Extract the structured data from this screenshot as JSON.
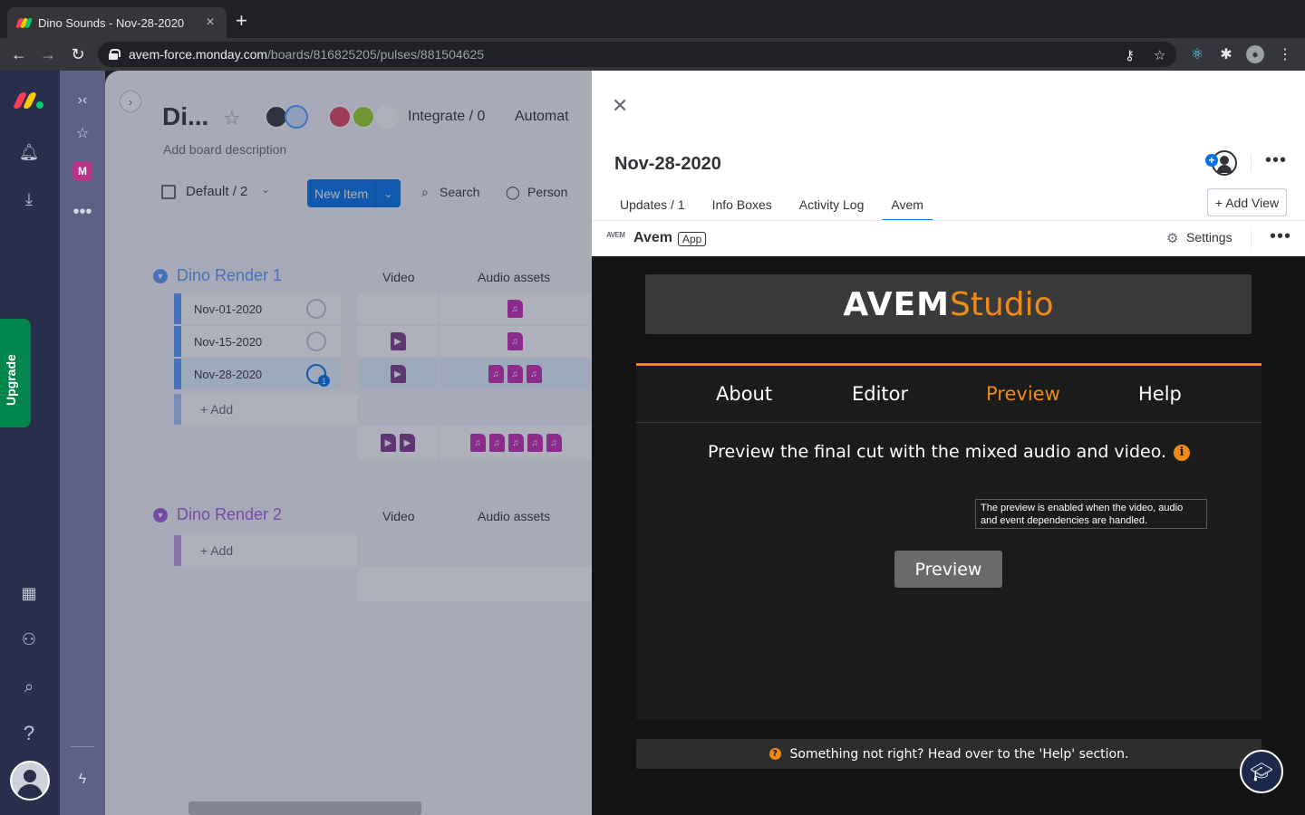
{
  "browser": {
    "tab_title": "Dino Sounds - Nov-28-2020",
    "url_host": "avem-force.monday.com",
    "url_path": "/boards/816825205/pulses/881504625"
  },
  "rail": {
    "upgrade_label": "Upgrade",
    "avatar_initial": "M"
  },
  "board": {
    "title": "Di...",
    "description": "Add board description",
    "integrate": "Integrate / 0",
    "automate": "Automat",
    "view": "Default / 2",
    "new_item": "New Item",
    "search": "Search",
    "person": "Person",
    "groups": [
      {
        "title": "Dino Render 1",
        "color": "#579bfc",
        "columns": [
          "Video",
          "Audio assets"
        ],
        "rows": [
          {
            "name": "Nov-01-2020",
            "video": 0,
            "audio": 1,
            "updates": ""
          },
          {
            "name": "Nov-15-2020",
            "video": 1,
            "audio": 1,
            "updates": ""
          },
          {
            "name": "Nov-28-2020",
            "video": 1,
            "audio": 3,
            "updates": "1"
          }
        ],
        "add_label": "+ Add",
        "summary_video": 2,
        "summary_audio": 5
      },
      {
        "title": "Dino Render 2",
        "color": "#a25ddc",
        "columns": [
          "Video",
          "Audio assets"
        ],
        "rows": [],
        "add_label": "+ Add"
      }
    ]
  },
  "panel": {
    "item_title": "Nov-28-2020",
    "tabs": [
      {
        "label": "Updates / 1",
        "active": false
      },
      {
        "label": "Info Boxes",
        "active": false
      },
      {
        "label": "Activity Log",
        "active": false
      },
      {
        "label": "Avem",
        "active": true
      }
    ],
    "add_view": "+ Add View",
    "app_name": "Avem",
    "app_badge": "App",
    "app_logo_text": "AVEM",
    "settings": "Settings"
  },
  "avem": {
    "brand_1": "AVEM",
    "brand_2": "Studio",
    "nav": [
      {
        "label": "About",
        "active": false
      },
      {
        "label": "Editor",
        "active": false
      },
      {
        "label": "Preview",
        "active": true
      },
      {
        "label": "Help",
        "active": false
      }
    ],
    "description": "Preview the final cut with the mixed audio and video.",
    "tooltip": "The preview is enabled when the video, audio and event dependencies are handled.",
    "preview_button": "Preview",
    "help_text": "Something not right? Head over to the 'Help' section.",
    "accent_color": "#f08a16"
  }
}
